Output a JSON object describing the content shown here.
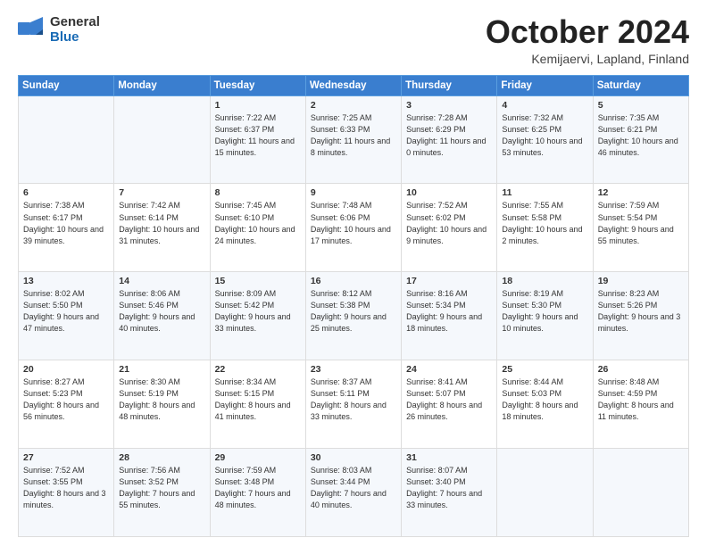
{
  "header": {
    "logo_general": "General",
    "logo_blue": "Blue",
    "month": "October 2024",
    "location": "Kemijaervi, Lapland, Finland"
  },
  "weekdays": [
    "Sunday",
    "Monday",
    "Tuesday",
    "Wednesday",
    "Thursday",
    "Friday",
    "Saturday"
  ],
  "weeks": [
    [
      {
        "day": "",
        "info": ""
      },
      {
        "day": "",
        "info": ""
      },
      {
        "day": "1",
        "info": "Sunrise: 7:22 AM\nSunset: 6:37 PM\nDaylight: 11 hours\nand 15 minutes."
      },
      {
        "day": "2",
        "info": "Sunrise: 7:25 AM\nSunset: 6:33 PM\nDaylight: 11 hours\nand 8 minutes."
      },
      {
        "day": "3",
        "info": "Sunrise: 7:28 AM\nSunset: 6:29 PM\nDaylight: 11 hours\nand 0 minutes."
      },
      {
        "day": "4",
        "info": "Sunrise: 7:32 AM\nSunset: 6:25 PM\nDaylight: 10 hours\nand 53 minutes."
      },
      {
        "day": "5",
        "info": "Sunrise: 7:35 AM\nSunset: 6:21 PM\nDaylight: 10 hours\nand 46 minutes."
      }
    ],
    [
      {
        "day": "6",
        "info": "Sunrise: 7:38 AM\nSunset: 6:17 PM\nDaylight: 10 hours\nand 39 minutes."
      },
      {
        "day": "7",
        "info": "Sunrise: 7:42 AM\nSunset: 6:14 PM\nDaylight: 10 hours\nand 31 minutes."
      },
      {
        "day": "8",
        "info": "Sunrise: 7:45 AM\nSunset: 6:10 PM\nDaylight: 10 hours\nand 24 minutes."
      },
      {
        "day": "9",
        "info": "Sunrise: 7:48 AM\nSunset: 6:06 PM\nDaylight: 10 hours\nand 17 minutes."
      },
      {
        "day": "10",
        "info": "Sunrise: 7:52 AM\nSunset: 6:02 PM\nDaylight: 10 hours\nand 9 minutes."
      },
      {
        "day": "11",
        "info": "Sunrise: 7:55 AM\nSunset: 5:58 PM\nDaylight: 10 hours\nand 2 minutes."
      },
      {
        "day": "12",
        "info": "Sunrise: 7:59 AM\nSunset: 5:54 PM\nDaylight: 9 hours\nand 55 minutes."
      }
    ],
    [
      {
        "day": "13",
        "info": "Sunrise: 8:02 AM\nSunset: 5:50 PM\nDaylight: 9 hours\nand 47 minutes."
      },
      {
        "day": "14",
        "info": "Sunrise: 8:06 AM\nSunset: 5:46 PM\nDaylight: 9 hours\nand 40 minutes."
      },
      {
        "day": "15",
        "info": "Sunrise: 8:09 AM\nSunset: 5:42 PM\nDaylight: 9 hours\nand 33 minutes."
      },
      {
        "day": "16",
        "info": "Sunrise: 8:12 AM\nSunset: 5:38 PM\nDaylight: 9 hours\nand 25 minutes."
      },
      {
        "day": "17",
        "info": "Sunrise: 8:16 AM\nSunset: 5:34 PM\nDaylight: 9 hours\nand 18 minutes."
      },
      {
        "day": "18",
        "info": "Sunrise: 8:19 AM\nSunset: 5:30 PM\nDaylight: 9 hours\nand 10 minutes."
      },
      {
        "day": "19",
        "info": "Sunrise: 8:23 AM\nSunset: 5:26 PM\nDaylight: 9 hours\nand 3 minutes."
      }
    ],
    [
      {
        "day": "20",
        "info": "Sunrise: 8:27 AM\nSunset: 5:23 PM\nDaylight: 8 hours\nand 56 minutes."
      },
      {
        "day": "21",
        "info": "Sunrise: 8:30 AM\nSunset: 5:19 PM\nDaylight: 8 hours\nand 48 minutes."
      },
      {
        "day": "22",
        "info": "Sunrise: 8:34 AM\nSunset: 5:15 PM\nDaylight: 8 hours\nand 41 minutes."
      },
      {
        "day": "23",
        "info": "Sunrise: 8:37 AM\nSunset: 5:11 PM\nDaylight: 8 hours\nand 33 minutes."
      },
      {
        "day": "24",
        "info": "Sunrise: 8:41 AM\nSunset: 5:07 PM\nDaylight: 8 hours\nand 26 minutes."
      },
      {
        "day": "25",
        "info": "Sunrise: 8:44 AM\nSunset: 5:03 PM\nDaylight: 8 hours\nand 18 minutes."
      },
      {
        "day": "26",
        "info": "Sunrise: 8:48 AM\nSunset: 4:59 PM\nDaylight: 8 hours\nand 11 minutes."
      }
    ],
    [
      {
        "day": "27",
        "info": "Sunrise: 7:52 AM\nSunset: 3:55 PM\nDaylight: 8 hours\nand 3 minutes."
      },
      {
        "day": "28",
        "info": "Sunrise: 7:56 AM\nSunset: 3:52 PM\nDaylight: 7 hours\nand 55 minutes."
      },
      {
        "day": "29",
        "info": "Sunrise: 7:59 AM\nSunset: 3:48 PM\nDaylight: 7 hours\nand 48 minutes."
      },
      {
        "day": "30",
        "info": "Sunrise: 8:03 AM\nSunset: 3:44 PM\nDaylight: 7 hours\nand 40 minutes."
      },
      {
        "day": "31",
        "info": "Sunrise: 8:07 AM\nSunset: 3:40 PM\nDaylight: 7 hours\nand 33 minutes."
      },
      {
        "day": "",
        "info": ""
      },
      {
        "day": "",
        "info": ""
      }
    ]
  ]
}
